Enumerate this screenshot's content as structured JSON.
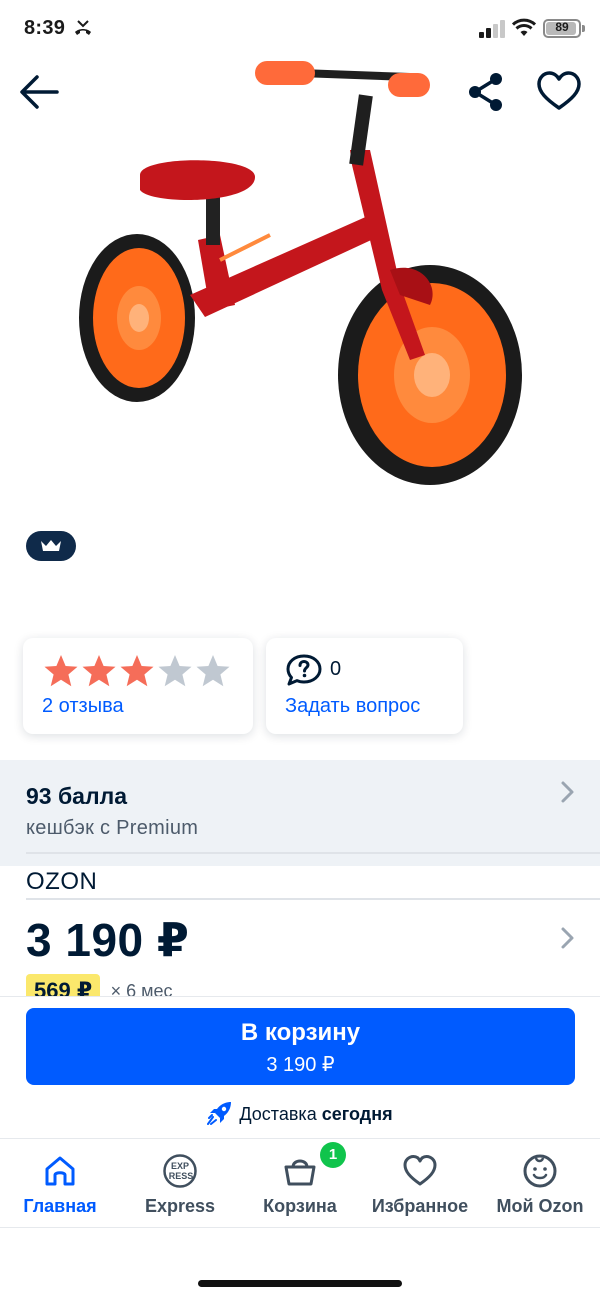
{
  "status_bar": {
    "time": "8:39",
    "battery": "89",
    "icons": [
      "missed-call-icon",
      "signal-icon",
      "wifi-icon",
      "battery-icon"
    ]
  },
  "header": {
    "icons": [
      "back-arrow-icon",
      "share-icon",
      "heart-icon"
    ]
  },
  "product": {
    "image_subject": "balance-bike",
    "badge_icon": "crown-icon"
  },
  "rating": {
    "stars": 3,
    "max_stars": 5,
    "reviews_label": "2 отзыва",
    "star_color": "#f56d59",
    "star_empty_color": "#c0c8d1"
  },
  "questions": {
    "count": "0",
    "ask_label": "Задать вопрос"
  },
  "cashback": {
    "title": "93 балла",
    "subtitle": "кешбэк с Premium"
  },
  "seller": {
    "name": "OZON"
  },
  "price": {
    "value": "3 190 ₽",
    "installment_amount": "569 ₽",
    "installment_term": "× 6 мес"
  },
  "cart_button": {
    "label": "В корзину",
    "price": "3 190 ₽",
    "color": "#005bff"
  },
  "delivery": {
    "prefix": "Доставка",
    "when": "сегодня"
  },
  "tab_bar": {
    "tabs": [
      {
        "label": "Главная",
        "icon": "home-icon",
        "active": true
      },
      {
        "label": "Express",
        "icon": "express-icon",
        "active": false
      },
      {
        "label": "Корзина",
        "icon": "basket-icon",
        "active": false
      },
      {
        "label": "Избранное",
        "icon": "heart-icon",
        "active": false
      },
      {
        "label": "Мой Ozon",
        "icon": "profile-icon",
        "active": false
      }
    ],
    "cart_count": "1",
    "express_icon_text": [
      "EXP",
      "RESS"
    ]
  }
}
